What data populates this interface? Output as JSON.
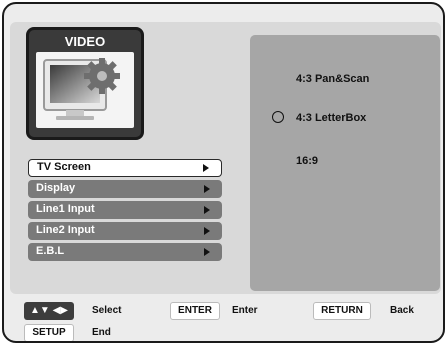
{
  "video_panel": {
    "title": "VIDEO",
    "icon": "tv-monitor-gear-icon"
  },
  "menu": {
    "items": [
      {
        "label": "TV Screen",
        "selected": true
      },
      {
        "label": "Display",
        "selected": false
      },
      {
        "label": "Line1 Input",
        "selected": false
      },
      {
        "label": "Line2 Input",
        "selected": false
      },
      {
        "label": "E.B.L",
        "selected": false
      }
    ]
  },
  "options": {
    "items": [
      {
        "label": "4:3 Pan&Scan",
        "selected": false
      },
      {
        "label": "4:3 LetterBox",
        "selected": true
      },
      {
        "label": "16:9",
        "selected": false
      }
    ]
  },
  "footer": {
    "nav_key": "▲▼ ◀▶",
    "select_label": "Select",
    "enter_key": "ENTER",
    "enter_label": "Enter",
    "return_key": "RETURN",
    "return_label": "Back",
    "setup_key": "SETUP",
    "setup_label": "End"
  },
  "colors": {
    "frame_border": "#1a1a1a",
    "panel_bg": "#d9d9d9",
    "menu_item_bg": "#7a7a7a",
    "options_bg": "#a6a6a6",
    "key_dark": "#3d3d3d"
  }
}
